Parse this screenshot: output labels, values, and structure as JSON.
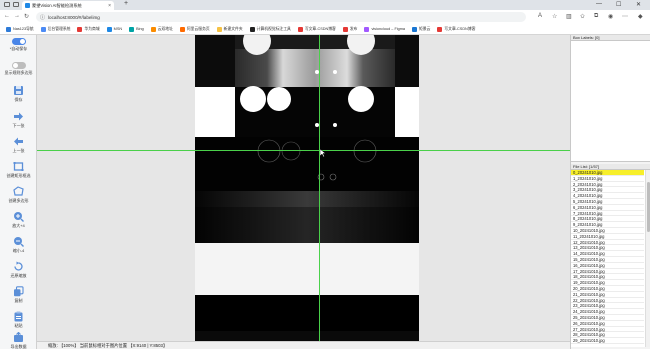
{
  "browser": {
    "tab_title": "蒙望Vision AI智能检测系统",
    "new_tab": "+",
    "url": "localhost:8000/#/labelimg",
    "win_controls": [
      "—",
      "☐",
      "✕"
    ]
  },
  "bookmarks": [
    {
      "label": "Nas123导航",
      "color": "#2e7bd8"
    },
    {
      "label": "后台管理系统",
      "color": "#4c8bf5"
    },
    {
      "label": "华为商城",
      "color": "#e53935"
    },
    {
      "label": "MSN",
      "color": "#1e88e5"
    },
    {
      "label": "Bing",
      "color": "#00a4a6"
    },
    {
      "label": "云双地址",
      "color": "#fb8c00"
    },
    {
      "label": "阿里云服务页",
      "color": "#ff6a00"
    },
    {
      "label": "新建文件夹",
      "color": "#f6c244"
    },
    {
      "label": "计算机视觉标注工具",
      "color": "#222222"
    },
    {
      "label": "写文章-CSDN博客",
      "color": "#e53935"
    },
    {
      "label": "发布",
      "color": "#e53935"
    },
    {
      "label": "visioncloud – Figma",
      "color": "#a259ff"
    },
    {
      "label": "矩景云",
      "color": "#1976d2"
    },
    {
      "label": "写文章-CSDN博客",
      "color": "#e53935"
    }
  ],
  "toolbar": {
    "auto_save_label": "*自动保存",
    "auto_save_on": true,
    "show_polygon_label": "显示规则多边形",
    "show_polygon_on": false,
    "buttons": [
      {
        "label": "保存",
        "icon": "save-icon",
        "name": "save-button"
      },
      {
        "label": "下一张",
        "icon": "arrow-right-icon",
        "name": "next-image-button"
      },
      {
        "label": "上一张",
        "icon": "arrow-left-icon",
        "name": "prev-image-button"
      },
      {
        "label": "创建矩形框选",
        "icon": "rectangle-icon",
        "name": "create-rect-button"
      },
      {
        "label": "创建多边形",
        "icon": "polygon-icon",
        "name": "create-polygon-button"
      },
      {
        "label": "放大+4",
        "icon": "zoom-in-icon",
        "name": "zoom-in-button"
      },
      {
        "label": "缩小-4",
        "icon": "zoom-out-icon",
        "name": "zoom-out-button"
      },
      {
        "label": "还原缩放",
        "icon": "reset-zoom-icon",
        "name": "reset-zoom-button"
      },
      {
        "label": "复制",
        "icon": "copy-icon",
        "name": "copy-button"
      },
      {
        "label": "粘贴",
        "icon": "paste-icon",
        "name": "paste-button"
      },
      {
        "label": "导出数据",
        "icon": "export-icon",
        "name": "export-button"
      }
    ],
    "accent": "#4a86e8"
  },
  "status": {
    "text": "缩放: 【100%】 当前鼠标相对于图片位置 【X:9140 | Y:8503】"
  },
  "right_panel": {
    "box_labels_title": "Box Labels: [0]",
    "file_list_title": "File List: [1/57]",
    "files": [
      "0_20241010.jpg",
      "1_20241010.jpg",
      "2_20241010.jpg",
      "3_20241010.jpg",
      "4_20241010.jpg",
      "5_20241010.jpg",
      "6_20241010.jpg",
      "7_20241010.jpg",
      "8_20241010.jpg",
      "9_20241010.jpg",
      "10_20241010.jpg",
      "11_20241010.jpg",
      "12_20241010.jpg",
      "13_20241010.jpg",
      "14_20241010.jpg",
      "15_20241010.jpg",
      "16_20241010.jpg",
      "17_20241010.jpg",
      "18_20241010.jpg",
      "19_20241010.jpg",
      "20_20241010.jpg",
      "21_20241010.jpg",
      "22_20241010.jpg",
      "23_20241010.jpg",
      "24_20241010.jpg",
      "25_20241010.jpg",
      "26_20241010.jpg",
      "27_20241010.jpg",
      "28_20241010.jpg",
      "29_20241010.jpg"
    ],
    "selected_index": 0,
    "highlight_color": "#f7ef2a"
  },
  "colors": {
    "crosshair": "#4ad04a",
    "canvas_bg": "#e6e6e6"
  }
}
